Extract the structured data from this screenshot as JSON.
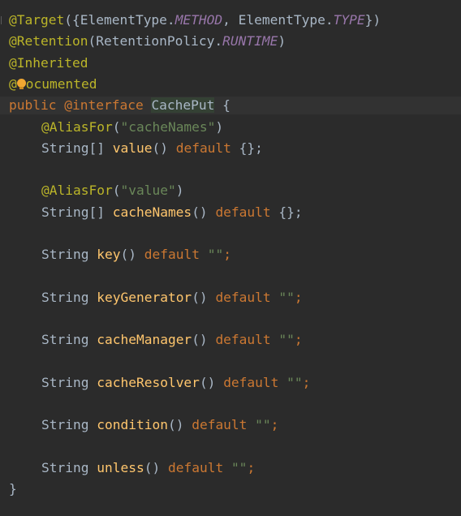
{
  "code": {
    "l1": {
      "a": "@Target",
      "b": "({ElementType.",
      "c": "METHOD",
      "d": ", ElementType.",
      "e": "TYPE",
      "f": "})"
    },
    "l2": {
      "a": "@Retention",
      "b": "(RetentionPolicy.",
      "c": "RUNTIME",
      "d": ")"
    },
    "l3": {
      "a": "@Inherited"
    },
    "l4": {
      "a": "@",
      "b": "ocumented"
    },
    "l5": {
      "a": "public ",
      "b": "@interface ",
      "c": "CachePut",
      "d": " {"
    },
    "l6": {
      "a": "@AliasFor",
      "b": "(",
      "c": "\"cacheNames\"",
      "d": ")"
    },
    "l7": {
      "a": "String[] ",
      "b": "value",
      "c": "() ",
      "d": "default ",
      "e": "{};"
    },
    "l8": {
      "a": "@AliasFor",
      "b": "(",
      "c": "\"value\"",
      "d": ")"
    },
    "l9": {
      "a": "String[] ",
      "b": "cacheNames",
      "c": "() ",
      "d": "default ",
      "e": "{};"
    },
    "l10": {
      "a": "String ",
      "b": "key",
      "c": "() ",
      "d": "default ",
      "e": "\"\"",
      "f": ";"
    },
    "l11": {
      "a": "String ",
      "b": "keyGenerator",
      "c": "() ",
      "d": "default ",
      "e": "\"\"",
      "f": ";"
    },
    "l12": {
      "a": "String ",
      "b": "cacheManager",
      "c": "() ",
      "d": "default ",
      "e": "\"\"",
      "f": ";"
    },
    "l13": {
      "a": "String ",
      "b": "cacheResolver",
      "c": "() ",
      "d": "default ",
      "e": "\"\"",
      "f": ";"
    },
    "l14": {
      "a": "String ",
      "b": "condition",
      "c": "() ",
      "d": "default ",
      "e": "\"\"",
      "f": ";"
    },
    "l15": {
      "a": "String ",
      "b": "unless",
      "c": "() ",
      "d": "default ",
      "e": "\"\"",
      "f": ";"
    },
    "l16": {
      "a": "}"
    }
  },
  "icons": {
    "bulb": "intention-bulb-icon"
  },
  "colors": {
    "background": "#2b2b2b",
    "annotation": "#bbb529",
    "keyword": "#cc7832",
    "string": "#6a8759",
    "constant": "#9876aa",
    "method": "#ffc66d",
    "text": "#a9b7c6"
  }
}
